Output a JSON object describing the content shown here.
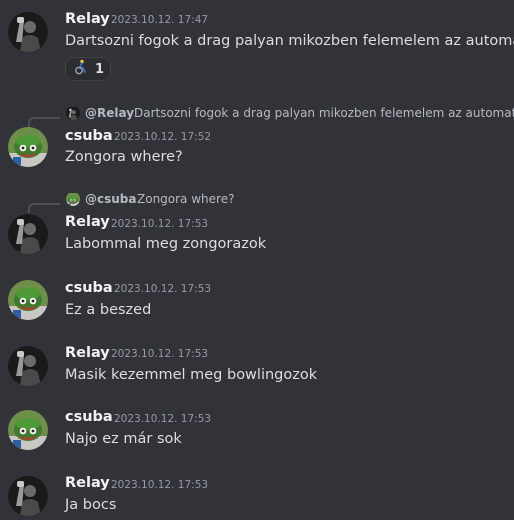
{
  "messages": [
    {
      "author": "Relay",
      "timestamp": "2023.10.12. 17:47",
      "text": "Dartsozni fogok a drag palyan mikozben felemelem az automat",
      "reaction": {
        "emoji": "wheelchair-person",
        "count": "1"
      }
    },
    {
      "author": "csuba",
      "timestamp": "2023.10.12. 17:52",
      "text": "Zongora where?",
      "reply": {
        "user": "@Relay",
        "text": "Dartsozni fogok a drag palyan mikozben felemelem az automat"
      }
    },
    {
      "author": "Relay",
      "timestamp": "2023.10.12. 17:53",
      "text": "Labommal meg zongorazok",
      "reply": {
        "user": "@csuba",
        "text": "Zongora where?"
      }
    },
    {
      "author": "csuba",
      "timestamp": "2023.10.12. 17:53",
      "text": "Ez a beszed"
    },
    {
      "author": "Relay",
      "timestamp": "2023.10.12. 17:53",
      "text": "Masik kezemmel meg bowlingozok"
    },
    {
      "author": "csuba",
      "timestamp": "2023.10.12. 17:53",
      "text": "Najo ez már sok"
    },
    {
      "author": "Relay",
      "timestamp": "2023.10.12. 17:53",
      "text": "Ja bocs"
    }
  ],
  "colors": {
    "background": "#313338",
    "username": "#f2f3f5",
    "timestamp": "#949ba4",
    "text": "#dbdee1",
    "reply_line": "#4e5058"
  },
  "icons": {
    "relay_avatar": "relay-avatar",
    "csuba_avatar": "csuba-avatar",
    "reaction_emoji": "wheelchair-person-icon"
  }
}
